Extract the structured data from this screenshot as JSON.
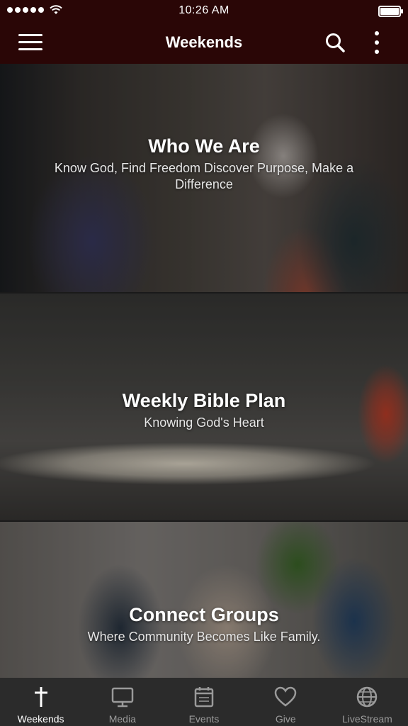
{
  "status_bar": {
    "time": "10:26 AM"
  },
  "app_bar": {
    "title": "Weekends"
  },
  "cards": [
    {
      "title": "Who We Are",
      "subtitle": "Know God, Find Freedom Discover Purpose, Make a Difference"
    },
    {
      "title": "Weekly Bible Plan",
      "subtitle": "Knowing God's Heart"
    },
    {
      "title": "Connect Groups",
      "subtitle": "Where Community Becomes Like Family."
    }
  ],
  "tabs": [
    {
      "label": "Weekends",
      "icon": "cross-icon",
      "active": true
    },
    {
      "label": "Media",
      "icon": "monitor-icon",
      "active": false
    },
    {
      "label": "Events",
      "icon": "calendar-icon",
      "active": false
    },
    {
      "label": "Give",
      "icon": "heart-icon",
      "active": false
    },
    {
      "label": "LiveStream",
      "icon": "globe-icon",
      "active": false
    }
  ],
  "colors": {
    "app_bar_bg": "#2a0606",
    "tab_bar_bg": "#2b2b2b",
    "tab_active": "#ffffff",
    "tab_inactive": "#9a9a9a"
  }
}
